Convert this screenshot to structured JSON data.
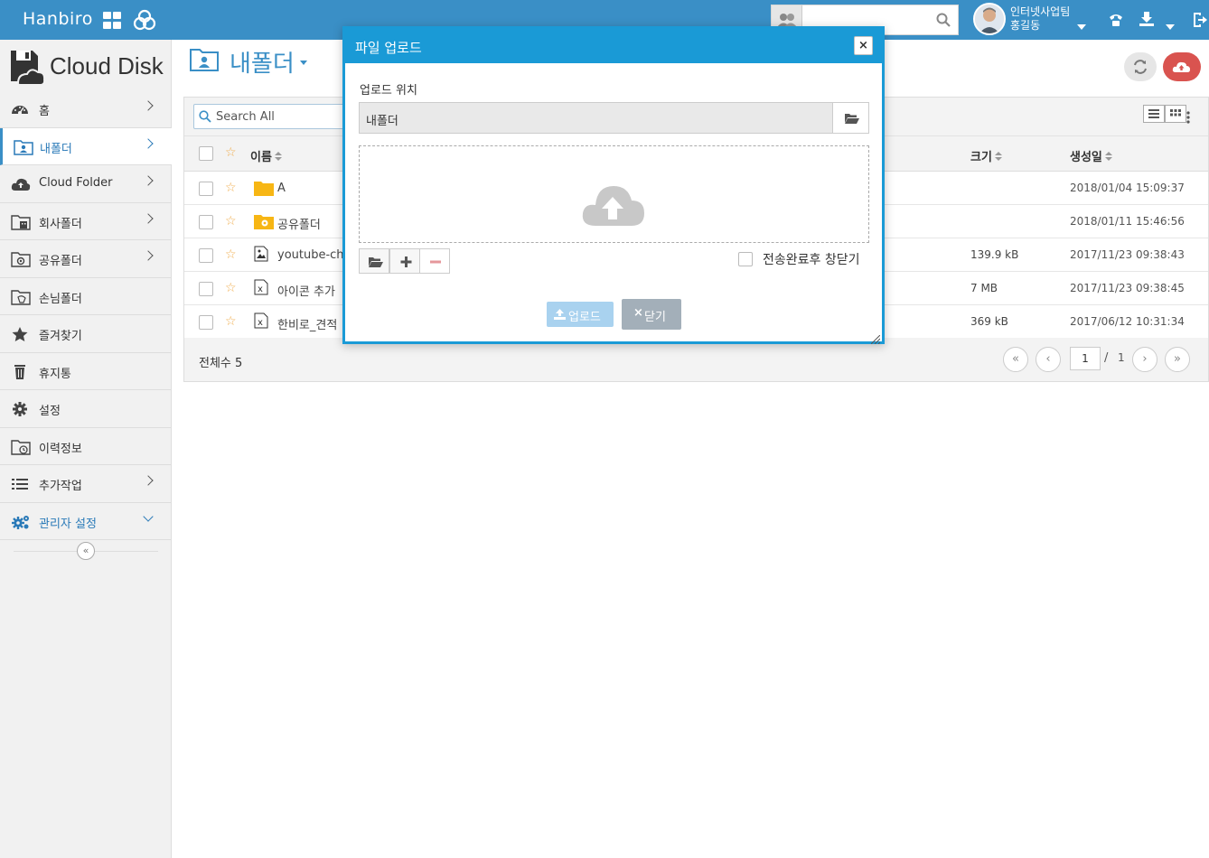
{
  "header": {
    "brand": "Hanbiro",
    "search_placeholder": "",
    "user": {
      "team": "인터넷사업팀",
      "name": "홍길동"
    }
  },
  "sidebar": {
    "app_title": "Cloud Disk",
    "items": [
      {
        "label": "홈",
        "icon": "dashboard-icon",
        "has_chevron": true
      },
      {
        "label": "내폴더",
        "icon": "my-folder-icon",
        "has_chevron": true,
        "active": true
      },
      {
        "label": "Cloud Folder",
        "icon": "cloud-upload-icon",
        "has_chevron": true
      },
      {
        "label": "회사폴더",
        "icon": "company-folder-icon",
        "has_chevron": true
      },
      {
        "label": "공유폴더",
        "icon": "shared-folder-icon",
        "has_chevron": true
      },
      {
        "label": "손님폴더",
        "icon": "guest-folder-icon",
        "has_chevron": false
      },
      {
        "label": "즐겨찾기",
        "icon": "star-icon",
        "has_chevron": false
      },
      {
        "label": "휴지통",
        "icon": "trash-icon",
        "has_chevron": false
      },
      {
        "label": "설정",
        "icon": "gear-icon",
        "has_chevron": false
      },
      {
        "label": "이력정보",
        "icon": "history-folder-icon",
        "has_chevron": false
      },
      {
        "label": "추가작업",
        "icon": "list-icon",
        "has_chevron": true
      },
      {
        "label": "관리자 설정",
        "icon": "admin-gears-icon",
        "has_chevron": true
      }
    ]
  },
  "main": {
    "folder_title": "내폴더",
    "search_placeholder": "Search All",
    "columns": {
      "name": "이름",
      "size": "크기",
      "created": "생성일"
    },
    "rows": [
      {
        "name": "A",
        "type": "folder",
        "size": "",
        "date": "2018/01/04 15:09:37"
      },
      {
        "name": "공유폴더",
        "type": "shared-folder",
        "size": "",
        "date": "2018/01/11 15:46:56"
      },
      {
        "name": "youtube-cha",
        "type": "image",
        "size": "139.9 kB",
        "date": "2017/11/23 09:38:43"
      },
      {
        "name": "아이콘 추가",
        "type": "excel",
        "size": "7 MB",
        "date": "2017/11/23 09:38:45"
      },
      {
        "name": "한비로_견적",
        "type": "excel",
        "size": "369 kB",
        "date": "2017/06/12 10:31:34"
      }
    ],
    "total_label": "전체수 5",
    "pagination": {
      "current": "1",
      "separator": "/",
      "total": "1"
    }
  },
  "modal": {
    "title": "파일 업로드",
    "close_symbol": "×",
    "location_label": "업로드 위치",
    "location_value": "내폴더",
    "close_after_label": "전송완료후 창닫기",
    "upload_button": "업로드",
    "close_button": "닫기"
  },
  "colors": {
    "header_blue": "#3a8fc6",
    "modal_blue": "#1a9ad6",
    "upload_red": "#d9534f",
    "star": "#f0ad4e",
    "folder": "#f7b614"
  }
}
